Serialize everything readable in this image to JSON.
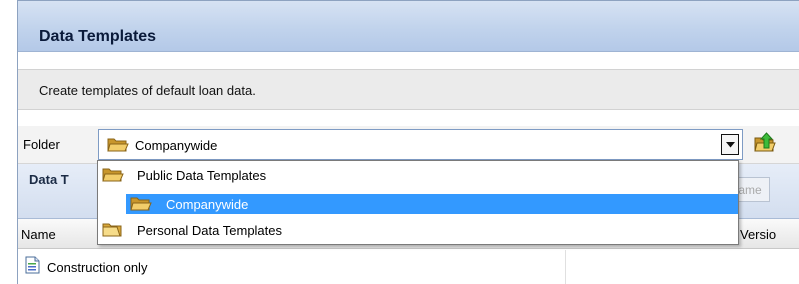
{
  "panel": {
    "title": "Data Templates",
    "description": "Create templates of default loan data."
  },
  "folder": {
    "label": "Folder",
    "selected": "Companywide",
    "options": [
      {
        "label": "Public Data Templates",
        "selected": false
      },
      {
        "label": "Companywide",
        "selected": true
      },
      {
        "label": "Personal Data Templates",
        "selected": false
      }
    ]
  },
  "section": {
    "title": "Data T",
    "rename_label": "ame"
  },
  "grid": {
    "columns": [
      "Name",
      "Versio"
    ],
    "rows": [
      {
        "name": "Construction only"
      }
    ]
  },
  "colors": {
    "selection": "#3399ff",
    "title_bar": "#c1d3ec",
    "folder_icon": "#e8b84a"
  },
  "icons": [
    "folder-icon",
    "dropdown-arrow-icon",
    "folder-up-icon",
    "document-icon"
  ]
}
